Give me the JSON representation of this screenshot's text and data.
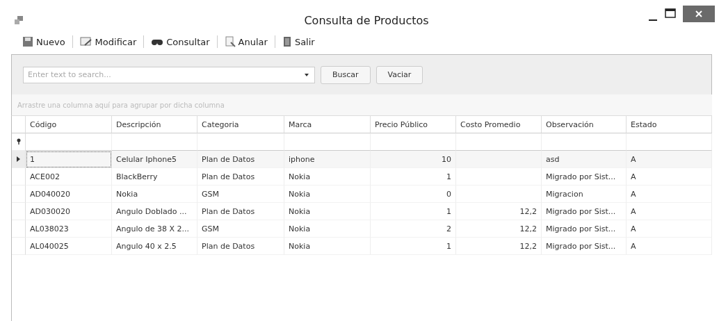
{
  "window": {
    "title": "Consulta de Productos"
  },
  "toolbar": [
    {
      "label": "Nuevo"
    },
    {
      "label": "Modificar"
    },
    {
      "label": "Consultar"
    },
    {
      "label": "Anular"
    },
    {
      "label": "Salir"
    }
  ],
  "search": {
    "placeholder": "Enter text to search...",
    "buttons": [
      "Buscar",
      "Vaciar"
    ]
  },
  "group_panel": {
    "hint": "Arrastre una columna aquí para agrupar por dicha columna"
  },
  "table": {
    "columns": [
      "Código",
      "Descripción",
      "Categoria",
      "Marca",
      "Precio Público",
      "Costo Promedio",
      "Observación",
      "Estado"
    ],
    "rows": [
      {
        "selected": true,
        "cells": [
          "1",
          "Celular Iphone5",
          "Plan de Datos",
          "iphone",
          "10",
          "",
          "asd",
          "A"
        ]
      },
      {
        "selected": false,
        "cells": [
          "ACE002",
          "BlackBerry",
          "Plan de Datos",
          "Nokia",
          "1",
          "",
          "Migrado por Sist...",
          "A"
        ]
      },
      {
        "selected": false,
        "cells": [
          "AD040020",
          "Nokia",
          "GSM",
          "Nokia",
          "0",
          "",
          "Migracion",
          "A"
        ]
      },
      {
        "selected": false,
        "cells": [
          "AD030020",
          "Angulo Doblado ...",
          "Plan de Datos",
          "Nokia",
          "1",
          "12,2",
          "Migrado por Sist...",
          "A"
        ]
      },
      {
        "selected": false,
        "cells": [
          "AL038023",
          "Angulo de 38 X 2...",
          "GSM",
          "Nokia",
          "2",
          "12,2",
          "Migrado por Sist...",
          "A"
        ]
      },
      {
        "selected": false,
        "cells": [
          "AL040025",
          "Angulo 40 x 2.5",
          "Plan de Datos",
          "Nokia",
          "1",
          "12,2",
          "Migrado por Sist...",
          "A"
        ]
      }
    ]
  }
}
